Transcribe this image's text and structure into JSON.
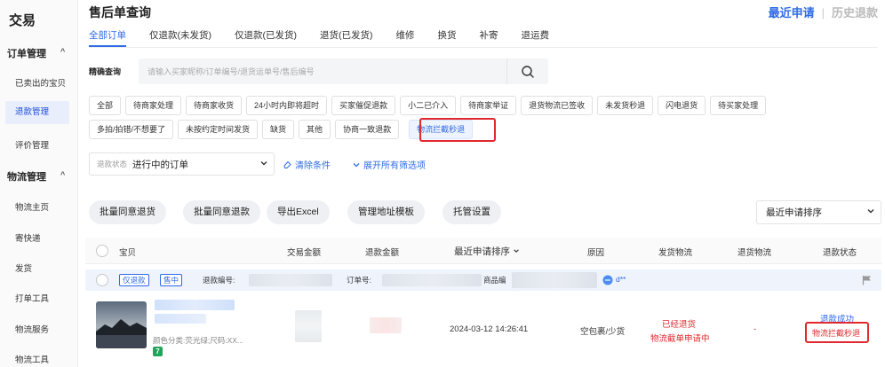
{
  "sidebar": {
    "title": "交易",
    "groups": [
      {
        "label": "订单管理",
        "items": [
          "已卖出的宝贝",
          "退款管理",
          "评价管理"
        ]
      },
      {
        "label": "物流管理",
        "items": [
          "物流主页",
          "寄快递",
          "发货",
          "打单工具",
          "物流服务",
          "物流工具"
        ]
      }
    ],
    "active_item": "退款管理",
    "chevron": "^"
  },
  "header": {
    "title": "售后单查询",
    "right_active": "最近申请",
    "right_inactive": "历史退款",
    "separator": "|"
  },
  "tabs": [
    "全部订单",
    "仅退款(未发货)",
    "仅退款(已发货)",
    "退货(已发货)",
    "维修",
    "换货",
    "补寄",
    "退运费"
  ],
  "search": {
    "label": "精确查询",
    "placeholder": "请输入买家昵称/订单编号/退货运单号/售后编号",
    "value": ""
  },
  "chips_row1": [
    "全部",
    "待商家处理",
    "待商家收货",
    "24小时内即将超时",
    "买家催促退款",
    "小二已介入",
    "待商家举证",
    "退货物流已签收",
    "未发货秒退",
    "闪电退货",
    "待买家处理"
  ],
  "chips_row2": [
    "多拍/拍错/不想要了",
    "未按约定时间发货",
    "缺货",
    "其他",
    "协商一致退款",
    "物流拦截秒退"
  ],
  "filter": {
    "label": "退款状态",
    "value": "进行中的订单",
    "clear_label": "清除条件",
    "expand_label": "展开所有筛选项"
  },
  "actions": [
    "批量同意退货",
    "批量同意退款",
    "导出Excel",
    "管理地址模板",
    "托管设置"
  ],
  "sort": {
    "value": "最近申请排序"
  },
  "table": {
    "headers": [
      "宝贝",
      "交易金额",
      "退款金额",
      "最近申请排序",
      "原因",
      "发货物流",
      "退货物流",
      "退款状态"
    ]
  },
  "order": {
    "tags": [
      "仅退款",
      "售中"
    ],
    "refund_no_label": "退款编号:",
    "order_no_label": "订单号:",
    "product_no_label": "商品编",
    "buyer": "d**"
  },
  "row": {
    "attr": "颜色分类:荧光绿;尺码:XX...",
    "badge": "7",
    "date": "2024-03-12 14:26:41",
    "reason": "空包裹/少货",
    "ship_status_1": "已经退货",
    "ship_status_2": "物流截单申请中",
    "return_logistics": "-",
    "refund_status": "退款成功",
    "refund_status_2": "物流拦截秒退"
  },
  "colors": {
    "accent": "#2f6be6",
    "highlight_red": "#e0282e"
  }
}
